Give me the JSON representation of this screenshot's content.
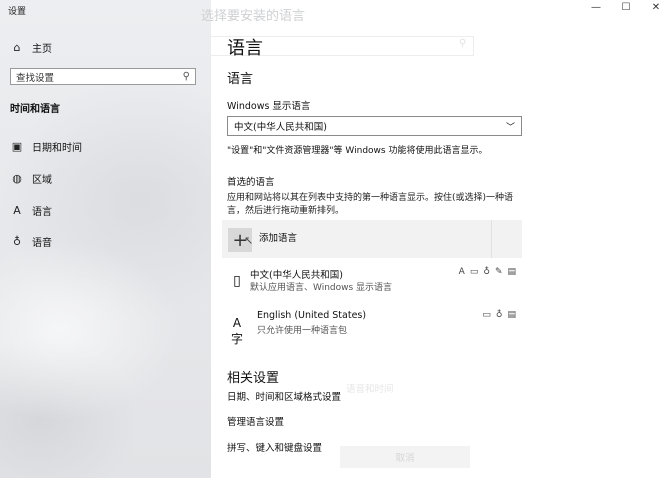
{
  "window": {
    "title": "设置",
    "minimize": "—",
    "maximize": "☐",
    "close": "✕"
  },
  "sidebar": {
    "home": "主页",
    "search_placeholder": "查找设置",
    "section": "时间和语言",
    "items": [
      {
        "label": "日期和时间",
        "icon": "calendar-clock-icon"
      },
      {
        "label": "区域",
        "icon": "globe-icon"
      },
      {
        "label": "语言",
        "icon": "language-icon"
      },
      {
        "label": "语音",
        "icon": "microphone-icon"
      }
    ]
  },
  "background_dialog": {
    "title": "选择要安装的语言",
    "time": "语音和时间",
    "cancel": "取消"
  },
  "main": {
    "page_title": "语言",
    "sub_title": "语言",
    "display_language_label": "Windows 显示语言",
    "display_language_value": "中文(中华人民共和国)",
    "display_note": "\"设置\"和\"文件资源管理器\"等 Windows 功能将使用此语言显示。",
    "preferred_label": "首选的语言",
    "preferred_desc": "应用和网站将以其在列表中支持的第一种语言显示。按住(或选择)一种语言，然后进行拖动重新排列。",
    "add_language": "添加语言",
    "languages": [
      {
        "name": "中文(中华人民共和国)",
        "sub": "默认应用语言、Windows 显示语言",
        "icon": "▯"
      },
      {
        "name": "English (United States)",
        "sub": "只允许使用一种语言包",
        "icon": "A字"
      }
    ],
    "related_title": "相关设置",
    "related_links": [
      "日期、时间和区域格式设置",
      "管理语言设置",
      "拼写、键入和键盘设置"
    ]
  }
}
